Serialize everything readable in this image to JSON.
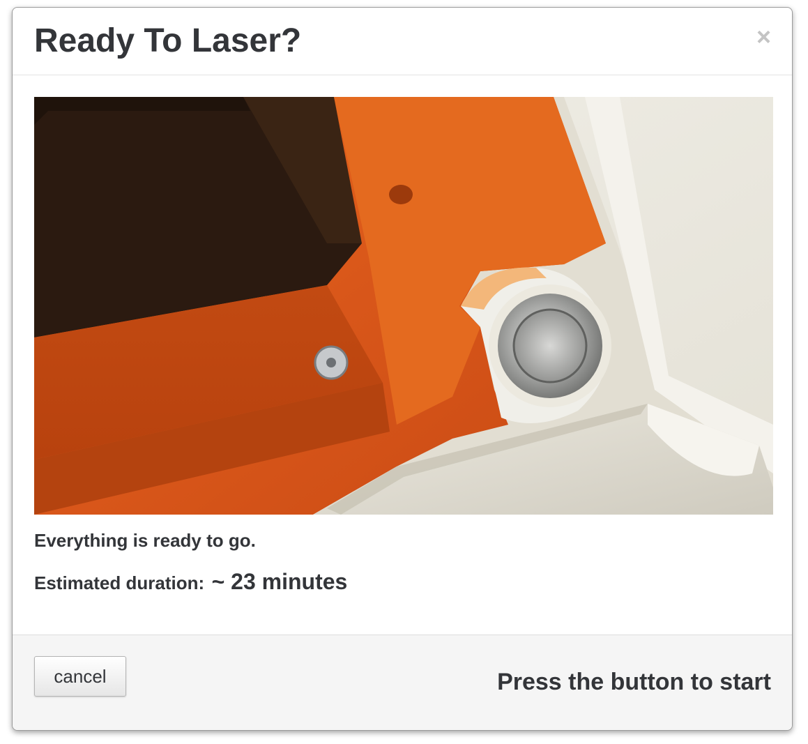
{
  "dialog": {
    "title": "Ready To Laser?",
    "close_glyph": "×"
  },
  "body": {
    "image": {
      "icon": "laser-cutter-start-button-photo",
      "colors": {
        "orange": "#d8561a",
        "cream": "#e9e6dc",
        "dark": "#2b1a10",
        "metal": "#b9bab8"
      }
    },
    "status_text": "Everything is ready to go.",
    "duration_label": "Estimated duration:",
    "duration_value": "~ 23 minutes"
  },
  "footer": {
    "cancel_label": "cancel",
    "start_hint": "Press the button to start"
  },
  "colors": {
    "text": "#333539",
    "footer_bg": "#f5f5f5",
    "close": "#c4c4c4"
  }
}
